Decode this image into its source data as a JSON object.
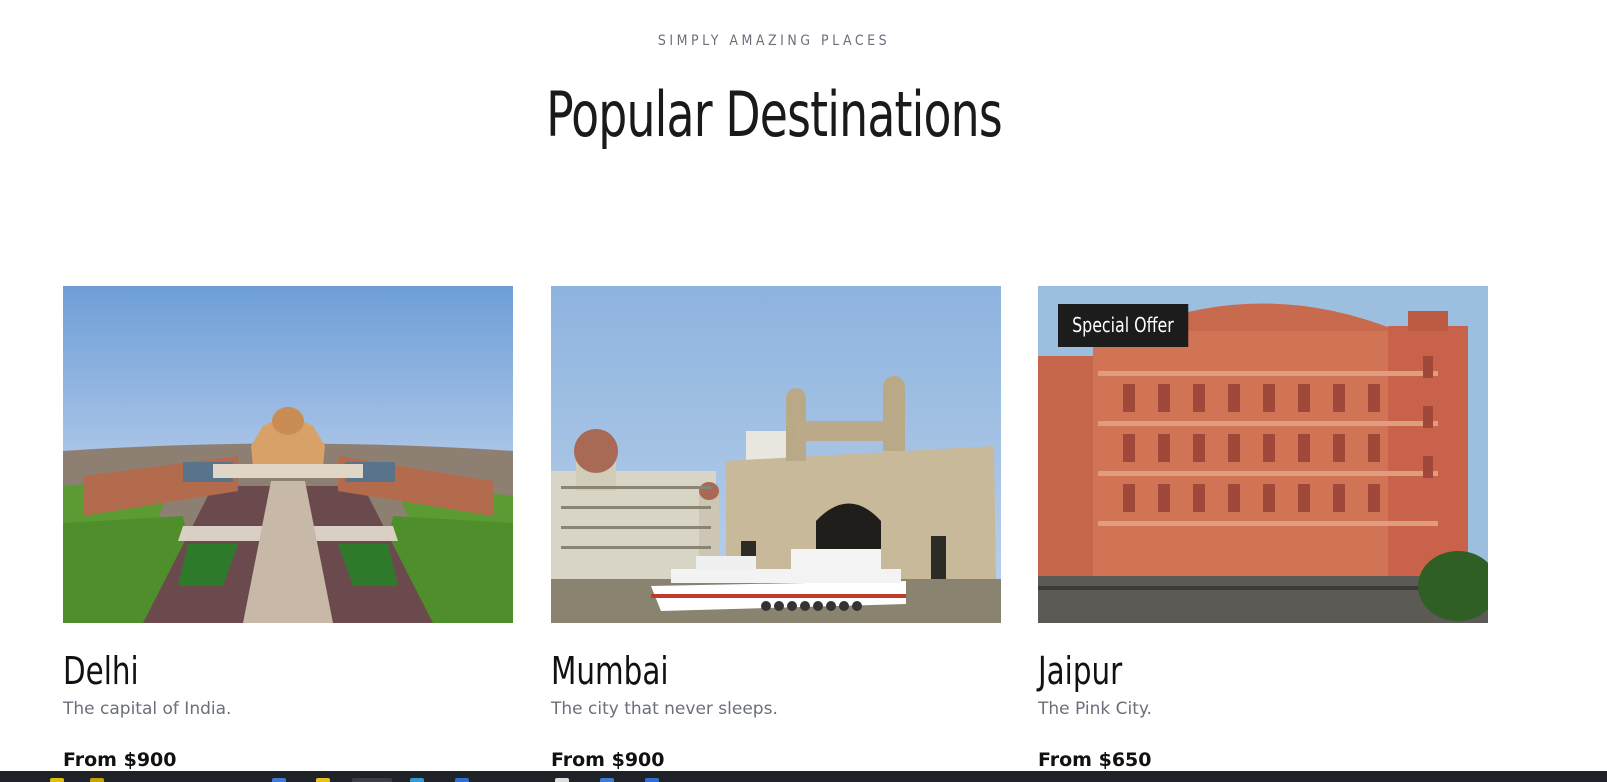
{
  "header": {
    "eyebrow": "SIMPLY AMAZING PLACES",
    "title": "Popular Destinations"
  },
  "destinations": [
    {
      "name": "Delhi",
      "description": "The capital of India.",
      "price": "From $900",
      "badge": ""
    },
    {
      "name": "Mumbai",
      "description": "The city that never sleeps.",
      "price": "From $900",
      "badge": ""
    },
    {
      "name": "Jaipur",
      "description": "The Pink City.",
      "price": "From $650",
      "badge": "Special Offer"
    }
  ],
  "colors": {
    "text_primary": "#111111",
    "text_muted": "#6b6f7b",
    "badge_bg": "#1c1c1c",
    "taskbar_bg": "#1f2226"
  }
}
